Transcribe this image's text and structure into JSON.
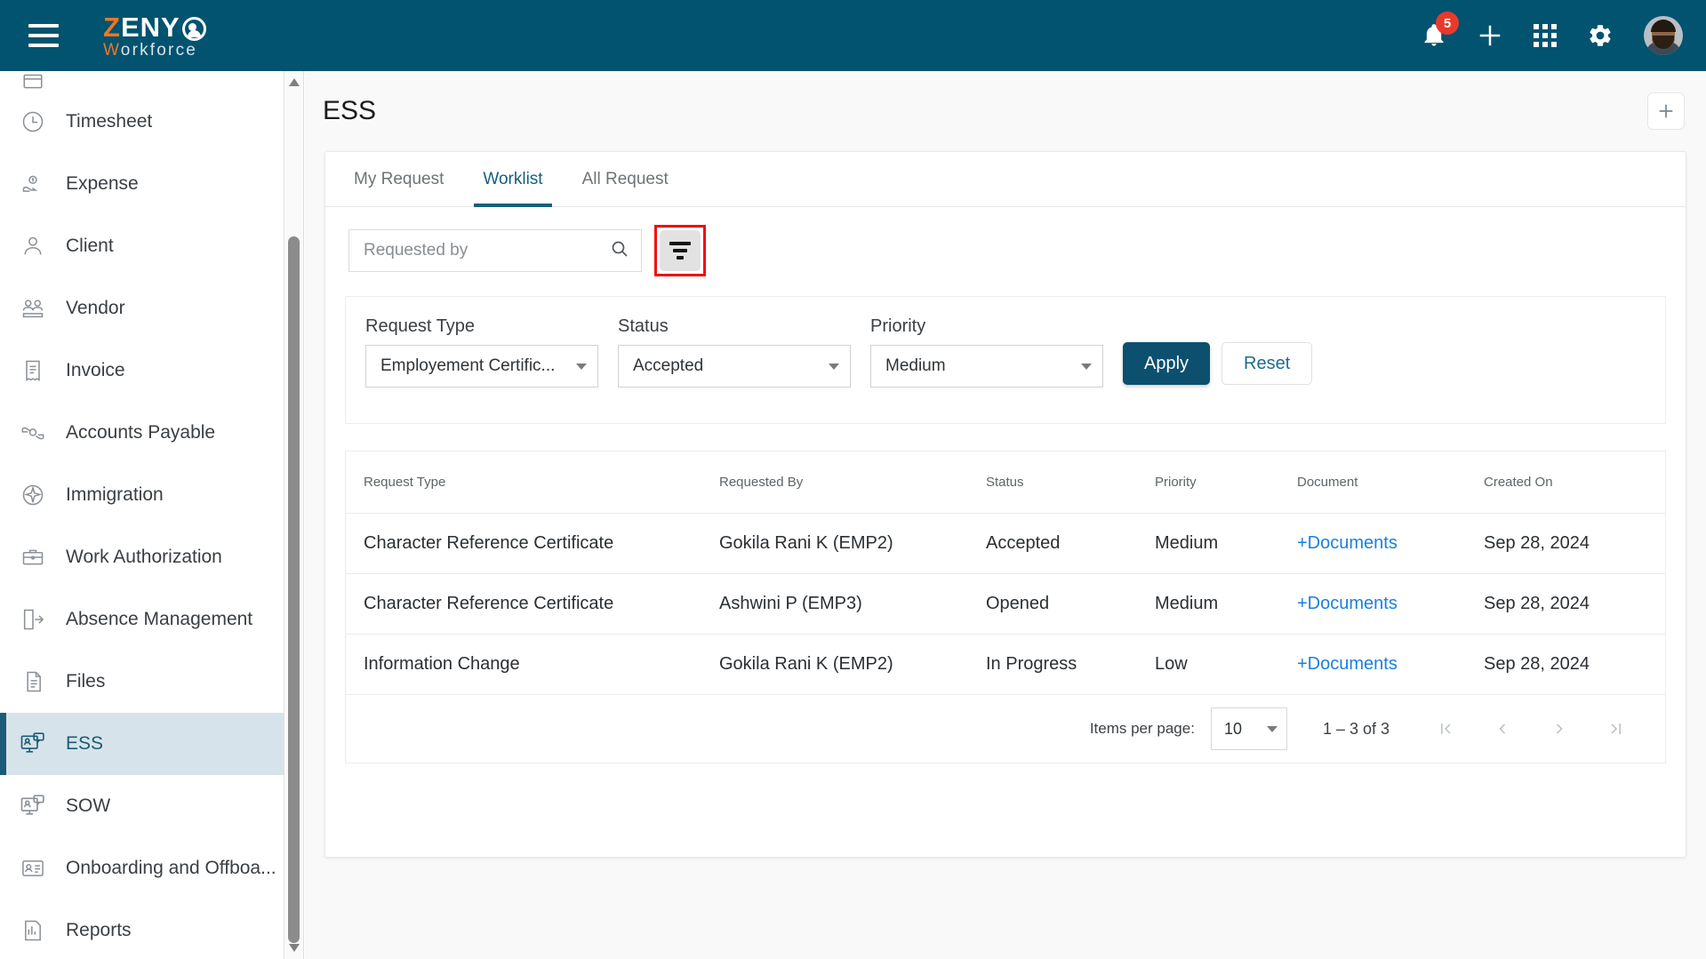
{
  "topbar": {
    "menu_icon": "hamburger-icon",
    "logo": {
      "part1": "Z",
      "part2": "ENY",
      "part3": "O",
      "part4": "W",
      "part5": "orkforce"
    },
    "notification_count": "5",
    "icons": [
      "bell-icon",
      "plus-icon",
      "apps-grid-icon",
      "gear-icon",
      "avatar"
    ],
    "brand_color": "#01536f",
    "accent_color": "#ef7622"
  },
  "sidebar": {
    "items": [
      {
        "label": "Timesheet",
        "icon": "clock-icon",
        "active": false
      },
      {
        "label": "Expense",
        "icon": "expense-hand-coin-icon",
        "active": false
      },
      {
        "label": "Client",
        "icon": "person-icon",
        "active": false
      },
      {
        "label": "Vendor",
        "icon": "vendor-people-icon",
        "active": false
      },
      {
        "label": "Invoice",
        "icon": "invoice-receipt-icon",
        "active": false
      },
      {
        "label": "Accounts Payable",
        "icon": "hands-coin-icon",
        "active": false
      },
      {
        "label": "Immigration",
        "icon": "airplane-globe-icon",
        "active": false
      },
      {
        "label": "Work Authorization",
        "icon": "briefcase-icon",
        "active": false
      },
      {
        "label": "Absence Management",
        "icon": "door-exit-icon",
        "active": false
      },
      {
        "label": "Files",
        "icon": "documents-icon",
        "active": false
      },
      {
        "label": "ESS",
        "icon": "ess-monitor-icon",
        "active": true
      },
      {
        "label": "SOW",
        "icon": "sow-monitor-icon",
        "active": false
      },
      {
        "label": "Onboarding and Offboa...",
        "icon": "id-card-icon",
        "active": false
      },
      {
        "label": "Reports",
        "icon": "report-chart-icon",
        "active": false
      }
    ],
    "active_bg": "#d6e3ea",
    "active_color": "#1b5b76"
  },
  "page": {
    "title": "ESS",
    "add_button_icon": "plus-icon"
  },
  "tabs": [
    {
      "label": "My Request",
      "active": false
    },
    {
      "label": "Worklist",
      "active": true
    },
    {
      "label": "All Request",
      "active": false
    }
  ],
  "search": {
    "placeholder": "Requested by",
    "value": "",
    "search_icon": "search-icon",
    "filter_icon": "filter-icon",
    "filter_highlighted": true,
    "highlight_color": "#f20d0d"
  },
  "filters": {
    "request_type": {
      "label": "Request Type",
      "value": "Employement Certific..."
    },
    "status": {
      "label": "Status",
      "value": "Accepted"
    },
    "priority": {
      "label": "Priority",
      "value": "Medium"
    },
    "apply_label": "Apply",
    "reset_label": "Reset",
    "apply_color": "#0d4f6e"
  },
  "table": {
    "headers": [
      "Request Type",
      "Requested By",
      "Status",
      "Priority",
      "Document",
      "Created On"
    ],
    "rows": [
      {
        "request_type": "Character Reference Certificate",
        "requested_by": "Gokila Rani K (EMP2)",
        "status": "Accepted",
        "priority": "Medium",
        "document": "+Documents",
        "created_on": "Sep 28, 2024"
      },
      {
        "request_type": "Character Reference Certificate",
        "requested_by": "Ashwini P (EMP3)",
        "status": "Opened",
        "priority": "Medium",
        "document": "+Documents",
        "created_on": "Sep 28, 2024"
      },
      {
        "request_type": "Information Change",
        "requested_by": "Gokila Rani K (EMP2)",
        "status": "In Progress",
        "priority": "Low",
        "document": "+Documents",
        "created_on": "Sep 28, 2024"
      }
    ]
  },
  "paginator": {
    "items_per_page_label": "Items per page:",
    "items_per_page_value": "10",
    "range_label": "1 – 3 of 3",
    "first_icon": "|<",
    "prev_icon": "‹",
    "next_icon": "›",
    "last_icon": ">|"
  }
}
